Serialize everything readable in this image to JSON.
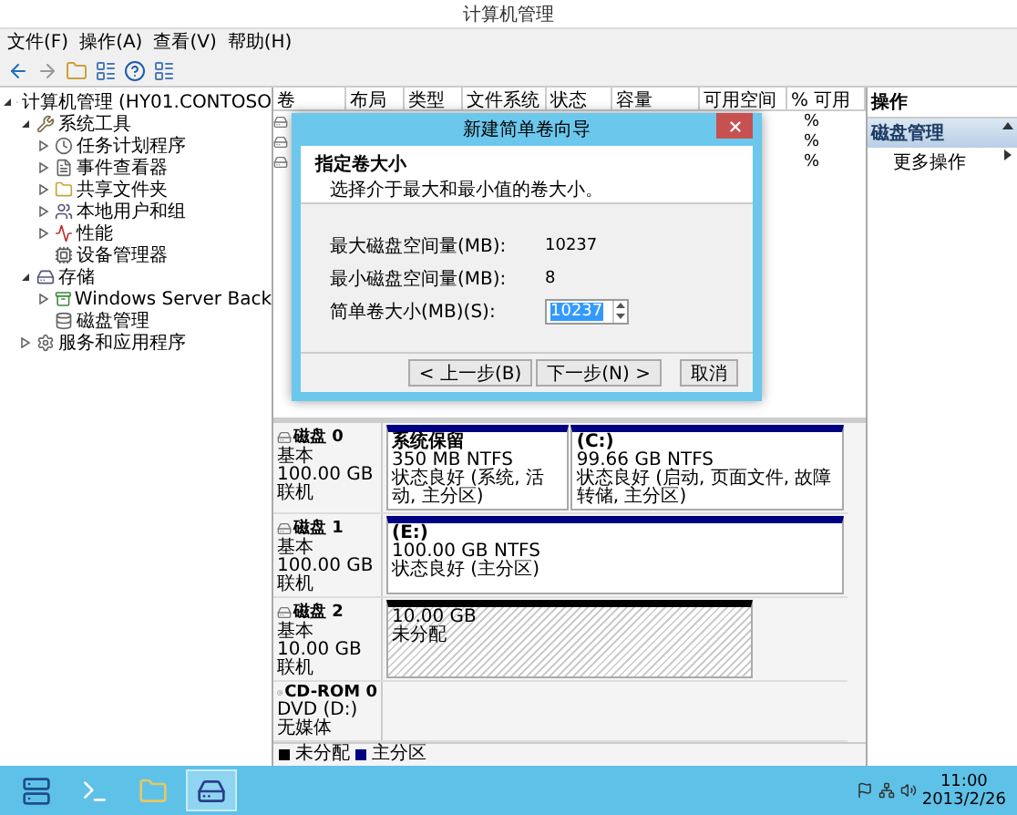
{
  "window": {
    "title": "计算机管理"
  },
  "menu": [
    "文件(F)",
    "操作(A)",
    "查看(V)",
    "帮助(H)"
  ],
  "tree": [
    {
      "label": "计算机管理 (HY01.CONTOSO",
      "expanded": true,
      "children": [
        {
          "label": "系统工具",
          "expanded": true,
          "children": [
            {
              "label": "任务计划程序",
              "expanded": false
            },
            {
              "label": "事件查看器",
              "expanded": false
            },
            {
              "label": "共享文件夹",
              "expanded": false
            },
            {
              "label": "本地用户和组",
              "expanded": false
            },
            {
              "label": "性能",
              "expanded": false
            },
            {
              "label": "设备管理器"
            }
          ]
        },
        {
          "label": "存储",
          "expanded": true,
          "children": [
            {
              "label": "Windows Server Back",
              "expanded": false
            },
            {
              "label": "磁盘管理"
            }
          ]
        },
        {
          "label": "服务和应用程序",
          "expanded": false
        }
      ]
    }
  ],
  "volume_table": {
    "columns": [
      "卷",
      "布局",
      "类型",
      "文件系统",
      "状态",
      "容量",
      "可用空间",
      "% 可用"
    ],
    "rows": [
      {
        "percent_free": "%"
      },
      {
        "percent_free": "%"
      },
      {
        "percent_free": "%"
      }
    ]
  },
  "disks": [
    {
      "kind": "disk",
      "name": "磁盘 0",
      "type": "基本",
      "size": "100.00 GB",
      "status": "联机",
      "partitions": [
        {
          "kind": "primary",
          "name": "系统保留",
          "size": "350 MB NTFS",
          "status": "状态良好 (系统, 活动, 主分区)"
        },
        {
          "kind": "primary",
          "name": "(C:)",
          "size": "99.66 GB NTFS",
          "status": "状态良好 (启动, 页面文件, 故障转储, 主分区)"
        }
      ]
    },
    {
      "kind": "disk",
      "name": "磁盘 1",
      "type": "基本",
      "size": "100.00 GB",
      "status": "联机",
      "partitions": [
        {
          "kind": "primary",
          "name": "(E:)",
          "size": "100.00 GB NTFS",
          "status": "状态良好 (主分区)"
        }
      ]
    },
    {
      "kind": "disk",
      "name": "磁盘 2",
      "type": "基本",
      "size": "10.00 GB",
      "status": "联机",
      "partitions": [
        {
          "kind": "unallocated",
          "size": "10.00 GB",
          "status": "未分配"
        }
      ]
    },
    {
      "kind": "cdrom",
      "name": "CD-ROM 0",
      "type": "DVD (D:)",
      "status": "无媒体"
    }
  ],
  "legend": [
    {
      "label": "未分配",
      "color": "#000000"
    },
    {
      "label": "主分区",
      "color": "#000080"
    }
  ],
  "actions": {
    "title": "操作",
    "items": [
      {
        "kind": "section",
        "label": "磁盘管理"
      },
      {
        "kind": "item",
        "label": "更多操作"
      }
    ]
  },
  "dialog": {
    "title": "新建简单卷向导",
    "heading": "指定卷大小",
    "subheading": "选择介于最大和最小值的卷大小。",
    "fields": [
      {
        "kind": "text",
        "label": "最大磁盘空间量(MB):",
        "value": "10237"
      },
      {
        "kind": "text",
        "label": "最小磁盘空间量(MB):",
        "value": "8"
      },
      {
        "kind": "spin",
        "label": "简单卷大小(MB)(S):",
        "value": "10237"
      }
    ],
    "buttons": [
      "< 上一步(B)",
      "下一步(N) >",
      "取消"
    ]
  },
  "taskbar": {
    "apps": [
      {
        "selected": false
      },
      {
        "selected": false
      },
      {
        "selected": false
      },
      {
        "selected": true
      }
    ],
    "time": "11:00",
    "date": "2013/2/26"
  }
}
